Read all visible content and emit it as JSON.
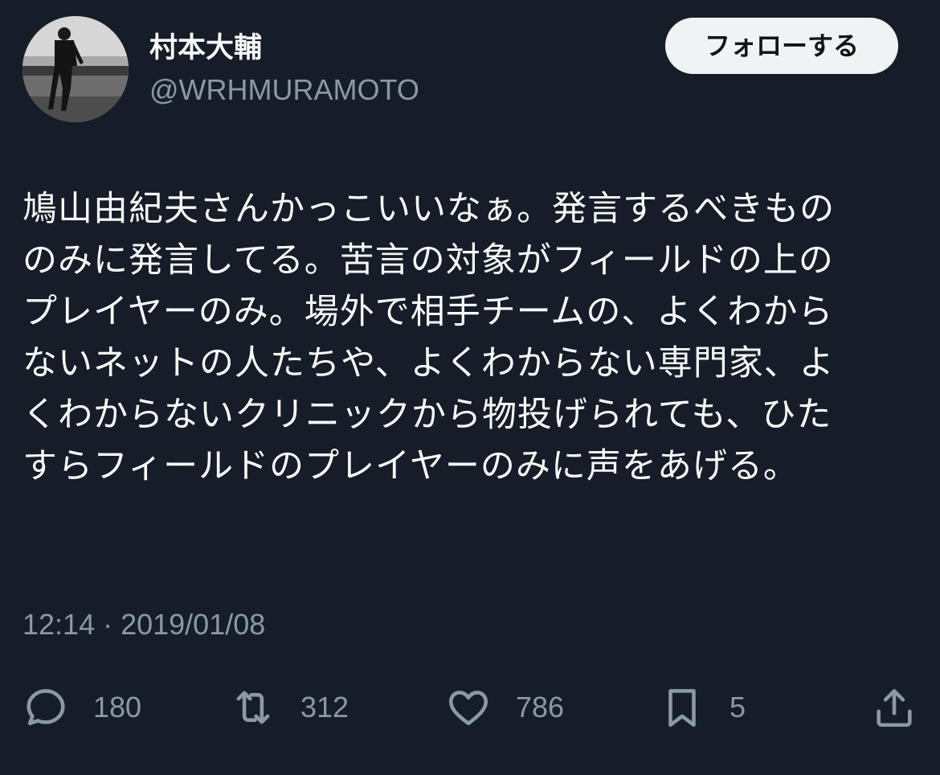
{
  "user": {
    "display_name": "村本大輔",
    "handle": "@WRHMURAMOTO"
  },
  "follow_button": {
    "label": "フォローする"
  },
  "tweet": {
    "lines": [
      "鳩山由紀夫さんかっこいいなぁ。発言するべきもの",
      "のみに発言してる。苦言の対象がフィールドの上の",
      "プレイヤーのみ。場外で相手チームの、よくわから",
      "ないネットの人たちや、よくわからない専門家、よ",
      "くわからないクリニックから物投げられても、ひた",
      "すらフィールドのプレイヤーのみに声をあげる。"
    ],
    "timestamp": "12:14 · 2019/01/08"
  },
  "actions": {
    "reply": {
      "icon": "reply-icon",
      "count": "180"
    },
    "retweet": {
      "icon": "retweet-icon",
      "count": "312"
    },
    "like": {
      "icon": "heart-icon",
      "count": "786"
    },
    "bookmark": {
      "icon": "bookmark-icon",
      "count": "5"
    },
    "share": {
      "icon": "share-icon"
    }
  },
  "colors": {
    "background": "#161d29",
    "primary_text": "#f7f9f9",
    "secondary_text": "#8b98a5",
    "follow_bg": "#eff3f4",
    "follow_text": "#0f1419"
  }
}
